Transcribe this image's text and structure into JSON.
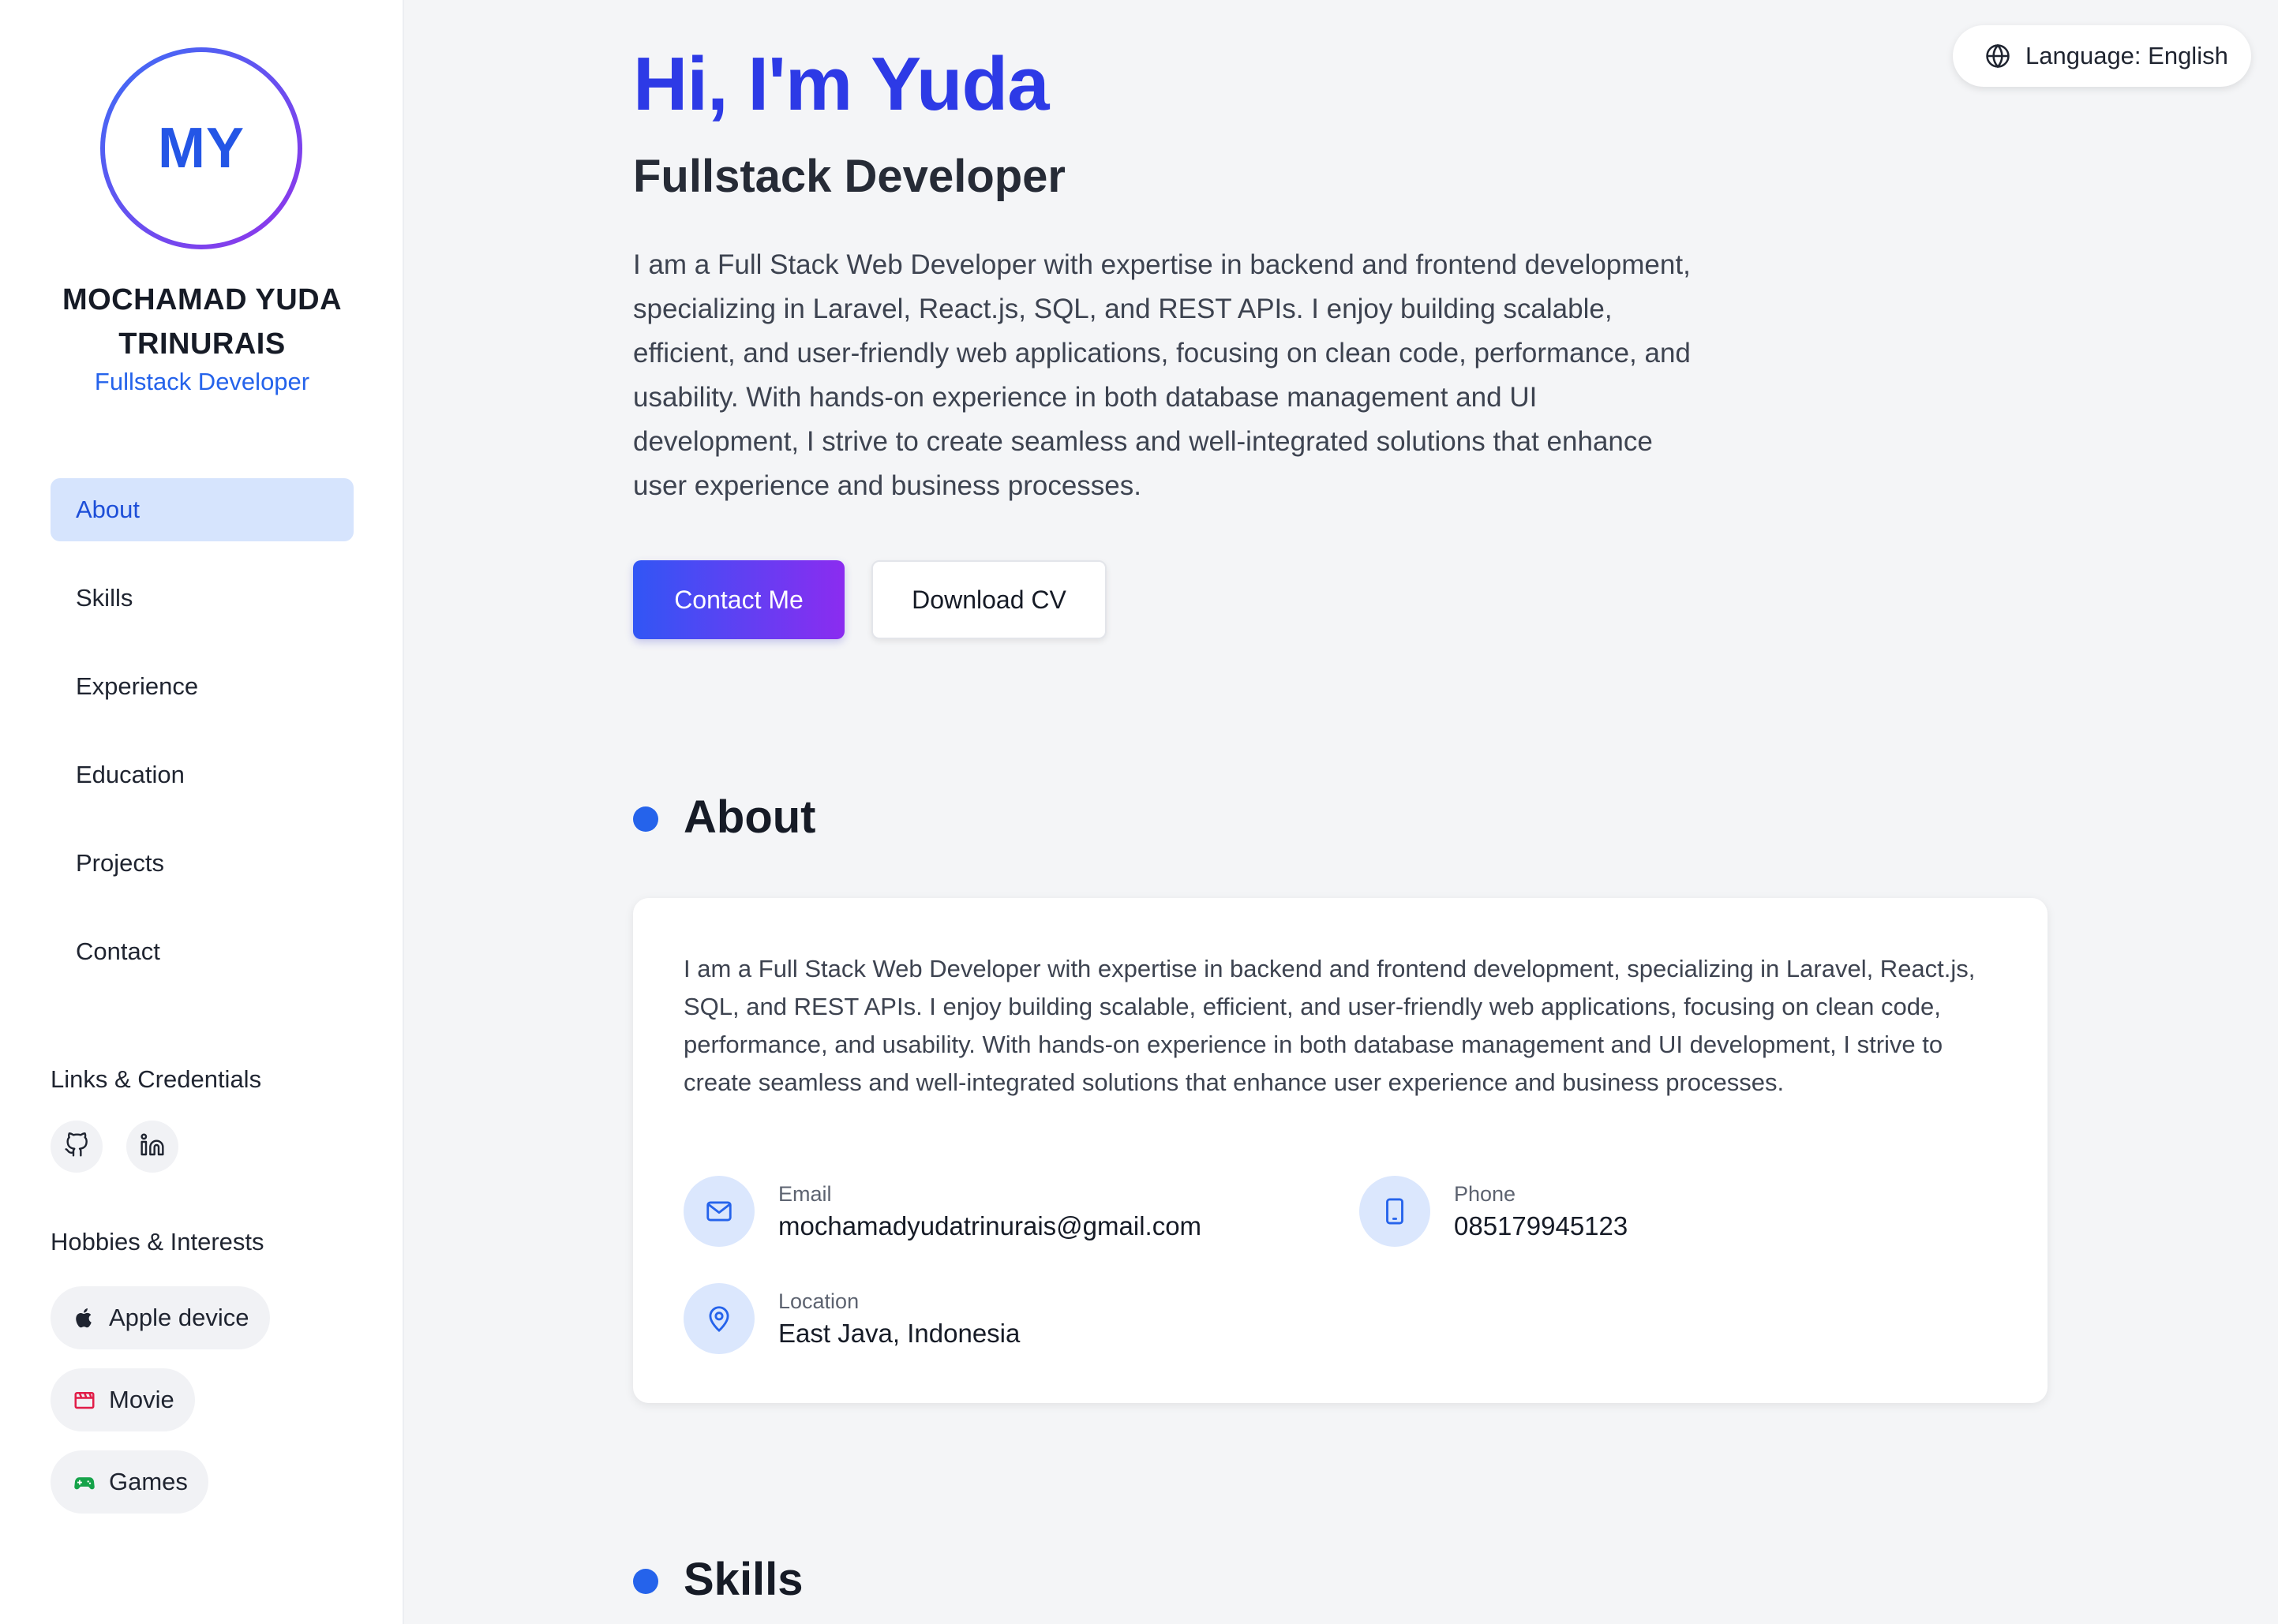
{
  "sidebar": {
    "avatar_initials": "MY",
    "name": "MOCHAMAD YUDA TRINURAIS",
    "role": "Fullstack Developer",
    "nav": [
      {
        "label": "About",
        "active": true
      },
      {
        "label": "Skills",
        "active": false
      },
      {
        "label": "Experience",
        "active": false
      },
      {
        "label": "Education",
        "active": false
      },
      {
        "label": "Projects",
        "active": false
      },
      {
        "label": "Contact",
        "active": false
      }
    ],
    "links_heading": "Links & Credentials",
    "links": [
      {
        "icon": "github-icon"
      },
      {
        "icon": "linkedin-icon"
      }
    ],
    "hobbies_heading": "Hobbies & Interests",
    "hobbies": [
      {
        "label": "Apple device",
        "icon": "apple-icon",
        "color": "#1f2430"
      },
      {
        "label": "Movie",
        "icon": "clapperboard-icon",
        "color": "#e11d48"
      },
      {
        "label": "Games",
        "icon": "gamepad-icon",
        "color": "#16a34a"
      }
    ]
  },
  "header": {
    "language_label": "Language: English"
  },
  "hero": {
    "title": "Hi, I'm Yuda",
    "subtitle": "Fullstack Developer",
    "description": "I am a Full Stack Web Developer with expertise in backend and frontend development, specializing in Laravel, React.js, SQL, and REST APIs. I enjoy building scalable, efficient, and user-friendly web applications, focusing on clean code, performance, and usability. With hands-on experience in both database management and UI development, I strive to create seamless and well-integrated solutions that enhance user experience and business processes.",
    "contact_button": "Contact Me",
    "download_button": "Download CV"
  },
  "about": {
    "title": "About",
    "text": "I am a Full Stack Web Developer with expertise in backend and frontend development, specializing in Laravel, React.js, SQL, and REST APIs. I enjoy building scalable, efficient, and user-friendly web applications, focusing on clean code, performance, and usability. With hands-on experience in both database management and UI development, I strive to create seamless and well-integrated solutions that enhance user experience and business processes.",
    "email_label": "Email",
    "email_value": "mochamadyudatrinurais@gmail.com",
    "phone_label": "Phone",
    "phone_value": "085179945123",
    "location_label": "Location",
    "location_value": "East Java, Indonesia"
  },
  "skills": {
    "title": "Skills"
  },
  "colors": {
    "accent": "#2563eb",
    "hero_title": "#2d3ae6",
    "gradient_start": "#3156f5",
    "gradient_end": "#8b2cf0"
  }
}
